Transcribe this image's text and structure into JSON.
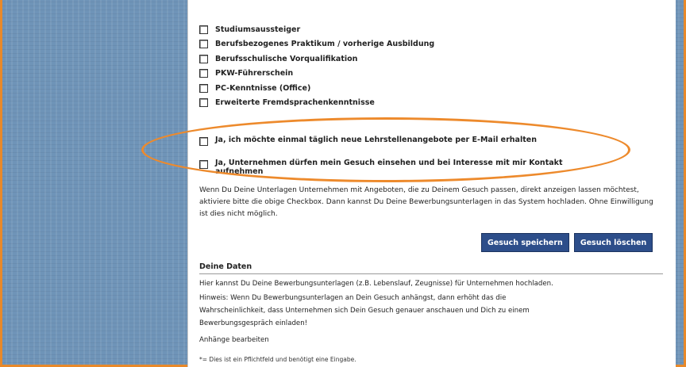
{
  "qualifications": {
    "items": [
      {
        "label": "Studiumsaussteiger"
      },
      {
        "label": "Berufsbezogenes Praktikum / vorherige Ausbildung"
      },
      {
        "label": "Berufsschulische Vorqualifikation"
      },
      {
        "label": "PKW-Führerschein"
      },
      {
        "label": "PC-Kenntnisse (Office)"
      },
      {
        "label": "Erweiterte Fremdsprachenkenntnisse"
      }
    ]
  },
  "options": {
    "email_daily": "Ja, ich möchte einmal täglich neue Lehrstellenangebote per E-Mail erhalten",
    "companies_view": "Ja, Unternehmen dürfen mein Gesuch einsehen und bei Interesse mit mir Kontakt aufnehmen"
  },
  "info_text": "Wenn Du Deine Unterlagen Unternehmen mit Angeboten, die zu Deinem Gesuch passen, direkt anzeigen lassen möchtest, aktiviere bitte die obige Checkbox. Dann kannst Du Deine Bewerbungsunterlagen in das System hochladen. Ohne Einwilligung ist dies nicht möglich.",
  "buttons": {
    "save": "Gesuch speichern",
    "delete": "Gesuch löschen"
  },
  "data_section": {
    "title": "Deine Daten",
    "line1": "Hier kannst Du Deine Bewerbungsunterlagen (z.B. Lebenslauf, Zeugnisse) für Unternehmen hochladen.",
    "line2": "Hinweis: Wenn Du Bewerbungsunterlagen an Dein Gesuch anhängst, dann erhöht das die",
    "line3": "Wahrscheinlichkeit, dass Unternehmen sich Dein Gesuch genauer anschauen und Dich zu einem",
    "line4": "Bewerbungsgespräch einladen!",
    "attachments_link": "Anhänge bearbeiten",
    "footnote": "*= Dies ist ein Pflichtfeld und benötigt eine Eingabe."
  },
  "colors": {
    "background": "#6f94b8",
    "highlight": "#ed8a2c",
    "button": "#2d4e8a"
  }
}
